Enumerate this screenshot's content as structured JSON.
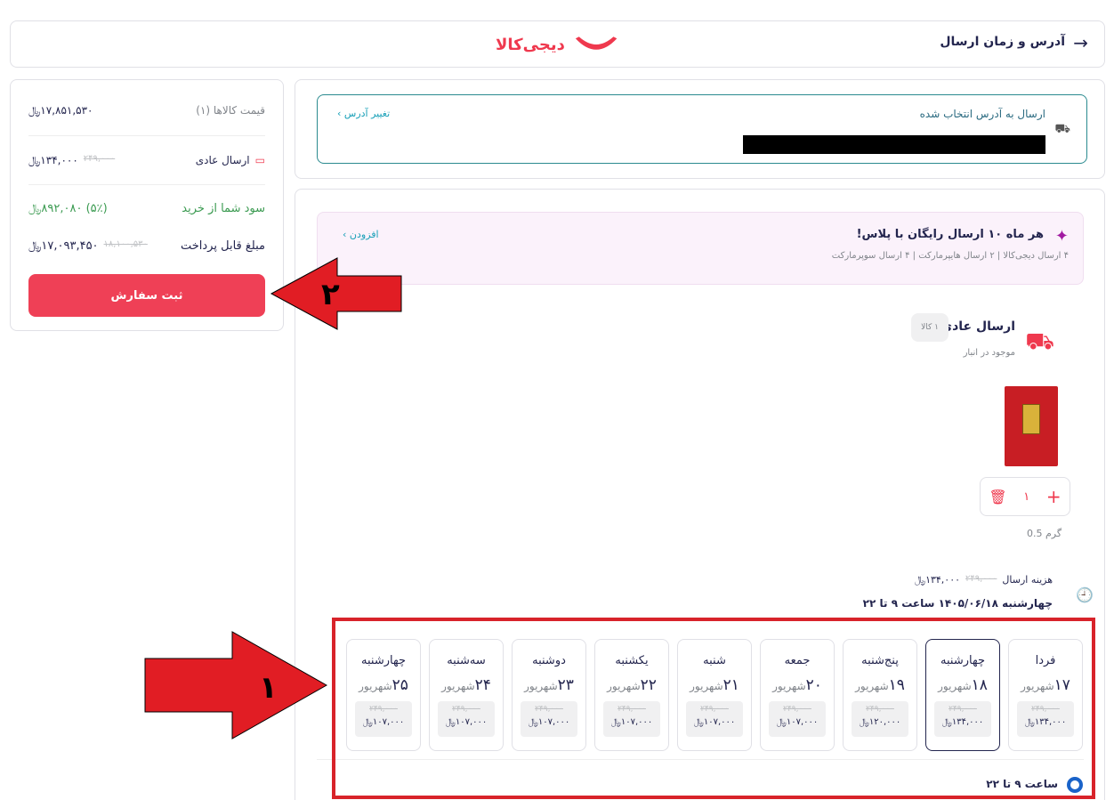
{
  "header": {
    "title": "آدرس و زمان ارسال",
    "logo_text": "دیجی‌کالا",
    "brand_color": "#ef394e"
  },
  "summary": {
    "items_price_label": "قیمت کالاها (۱)",
    "items_price_value": "۱۷,۸۵۱,۵۳۰﷼",
    "shipping_label": "ارسال عادی",
    "shipping_old": "۲۴۹,۰۰۰",
    "shipping_value": "۱۳۴,۰۰۰﷼",
    "profit_label": "سود شما از خرید",
    "profit_value": "(۵٪) ۸۹۲,۰۸۰﷼",
    "payable_label": "مبلغ قابل پرداخت",
    "payable_old": "۱۸,۱۰۰,۵۳۰",
    "payable_value": "۱۷,۰۹۳,۴۵۰﷼",
    "order_button": "ثبت سفارش"
  },
  "address": {
    "title": "ارسال به آدرس انتخاب شده",
    "change_link": "تغییر آدرس"
  },
  "plus": {
    "title": "هر ماه ۱۰ ارسال رایگان با پلاس!",
    "subtitle": "۴ ارسال دیجی‌کالا | ۲ ارسال هایپرمارکت | ۴ ارسال سوپرمارکت",
    "add_link": "افزودن"
  },
  "shipment": {
    "title": "ارسال عادی",
    "count_badge": "۱ کالا",
    "stock": "موجود در انبار",
    "quantity": "۱",
    "weight": "0.5 گرم",
    "cost_label": "هزینه ارسال",
    "cost_old": "۲۴۹,۰۰۰",
    "cost_value": "۱۳۴,۰۰۰﷼",
    "selected_time": "چهارشنبه ۱۴۰۵/۰۶/۱۸ ساعت ۹ تا ۲۲"
  },
  "days": [
    {
      "name": "فردا",
      "num": "۱۷",
      "month": "شهریور",
      "old": "۲۴۹,۰۰۰",
      "price": "۱۳۴,۰۰۰﷼",
      "selected": false
    },
    {
      "name": "چهارشنبه",
      "num": "۱۸",
      "month": "شهریور",
      "old": "۲۴۹,۰۰۰",
      "price": "۱۳۴,۰۰۰﷼",
      "selected": true
    },
    {
      "name": "پنج‌شنبه",
      "num": "۱۹",
      "month": "شهریور",
      "old": "۲۴۹,۰۰۰",
      "price": "۱۲۰,۰۰۰﷼",
      "selected": false
    },
    {
      "name": "جمعه",
      "num": "۲۰",
      "month": "شهریور",
      "old": "۲۴۹,۰۰۰",
      "price": "۱۰۷,۰۰۰﷼",
      "selected": false
    },
    {
      "name": "شنبه",
      "num": "۲۱",
      "month": "شهریور",
      "old": "۲۴۹,۰۰۰",
      "price": "۱۰۷,۰۰۰﷼",
      "selected": false
    },
    {
      "name": "یکشنبه",
      "num": "۲۲",
      "month": "شهریور",
      "old": "۲۴۹,۰۰۰",
      "price": "۱۰۷,۰۰۰﷼",
      "selected": false
    },
    {
      "name": "دوشنبه",
      "num": "۲۳",
      "month": "شهریور",
      "old": "۲۴۹,۰۰۰",
      "price": "۱۰۷,۰۰۰﷼",
      "selected": false
    },
    {
      "name": "سه‌شنبه",
      "num": "۲۴",
      "month": "شهریور",
      "old": "۲۴۹,۰۰۰",
      "price": "۱۰۷,۰۰۰﷼",
      "selected": false
    },
    {
      "name": "چهارشنبه",
      "num": "۲۵",
      "month": "شهریور",
      "old": "۲۴۹,۰۰۰",
      "price": "۱۰۷,۰۰۰﷼",
      "selected": false
    }
  ],
  "time_slot": "ساعت ۹ تا ۲۲",
  "annotations": {
    "arrow1_label": "۱",
    "arrow2_label": "۲",
    "color": "#e11d24"
  }
}
